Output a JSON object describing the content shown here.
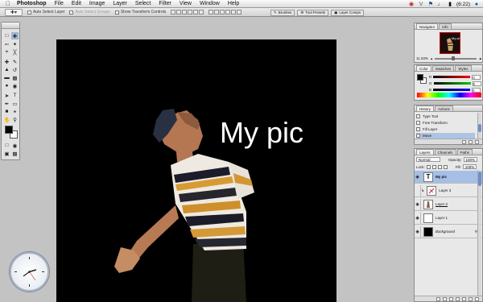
{
  "menubar": {
    "app": "Photoshop",
    "items": [
      "File",
      "Edit",
      "Image",
      "Layer",
      "Select",
      "Filter",
      "View",
      "Window",
      "Help"
    ],
    "status": {
      "battery": "(6:22)"
    }
  },
  "options": {
    "auto_select_layer": "Auto Select Layer",
    "auto_select_groups": "Auto Select Groups",
    "show_transform_controls": "Show Transform Controls"
  },
  "palette_well": {
    "tabs": [
      "Brushes",
      "Tool Presets",
      "Layer Comps"
    ]
  },
  "document": {
    "text_layer": "My pic"
  },
  "navigator": {
    "tabs": [
      "Navigator",
      "Info"
    ],
    "zoom": "11.33%"
  },
  "color_panel": {
    "tabs": [
      "Color",
      "Swatches",
      "Styles"
    ],
    "channels": [
      {
        "label": "R",
        "value": "0",
        "color": "#d03030"
      },
      {
        "label": "G",
        "value": "0",
        "color": "#30a030"
      },
      {
        "label": "B",
        "value": "0",
        "color": "#3040d0"
      }
    ]
  },
  "history_panel": {
    "tabs": [
      "History",
      "Actions"
    ],
    "items": [
      "Type Tool",
      "Free Transform",
      "Fill Layer",
      "Move"
    ],
    "selected_index": 3
  },
  "layers_panel": {
    "tabs": [
      "Layers",
      "Channels",
      "Paths"
    ],
    "blend_mode": "Normal",
    "opacity_label": "Opacity:",
    "opacity": "100%",
    "lock_label": "Lock:",
    "fill_label": "Fill:",
    "fill": "100%",
    "layers": [
      {
        "name": "My pic",
        "thumb": "T",
        "selected": true
      },
      {
        "name": "Layer 3",
        "thumb": "",
        "selected": false
      },
      {
        "name": "Layer 2",
        "thumb": "",
        "selected": false
      },
      {
        "name": "Layer 1",
        "thumb": "",
        "selected": false
      },
      {
        "name": "Background",
        "thumb": "",
        "selected": false
      }
    ]
  },
  "colors": {
    "accent_selection": "#a5bfe6",
    "canvas_bg": "#000000",
    "foreground": "#000000",
    "background_swatch": "#ffffff"
  }
}
